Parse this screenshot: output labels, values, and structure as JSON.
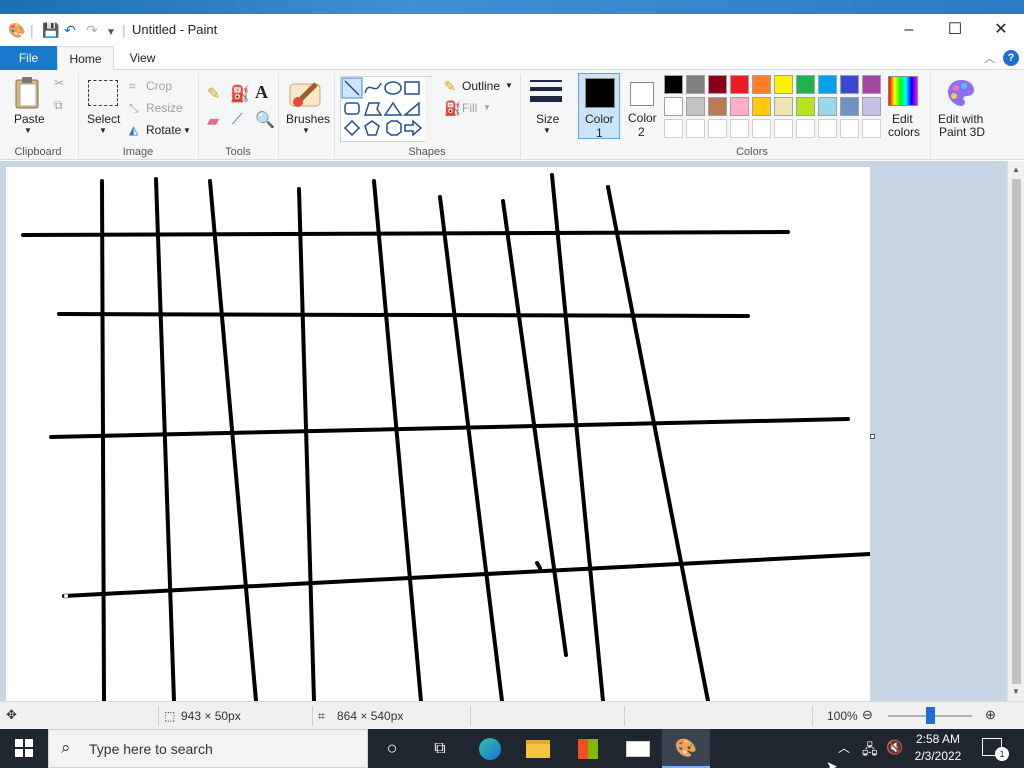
{
  "window": {
    "title": "Untitled - Paint"
  },
  "menu_tabs": {
    "file": "File",
    "home": "Home",
    "view": "View"
  },
  "ribbon": {
    "clipboard": {
      "paste": "Paste",
      "group": "Clipboard"
    },
    "image": {
      "select": "Select",
      "crop": "Crop",
      "resize": "Resize",
      "rotate": "Rotate",
      "group": "Image"
    },
    "tools": {
      "group": "Tools"
    },
    "brushes": {
      "label": "Brushes"
    },
    "shapes": {
      "outline": "Outline",
      "fill": "Fill",
      "group": "Shapes"
    },
    "size": {
      "label": "Size"
    },
    "colors": {
      "color1_label": "Color",
      "color1_num": "1",
      "color2_label": "Color",
      "color2_num": "2",
      "edit_colors_1": "Edit",
      "edit_colors_2": "colors",
      "group": "Colors",
      "color1": "#000000",
      "color2": "#ffffff",
      "palette_row1": [
        "#000000",
        "#7f7f7f",
        "#880015",
        "#ed1c24",
        "#ff7f27",
        "#fff200",
        "#22b14c",
        "#00a2e8",
        "#3f48cc",
        "#a349a4"
      ],
      "palette_row2": [
        "#ffffff",
        "#c3c3c3",
        "#b97a57",
        "#ffaec9",
        "#ffc90e",
        "#efe4b0",
        "#b5e61d",
        "#99d9ea",
        "#7092be",
        "#c8bfe7"
      ],
      "palette_row3": [
        "#ffffff",
        "#ffffff",
        "#ffffff",
        "#ffffff",
        "#ffffff",
        "#ffffff",
        "#ffffff",
        "#ffffff",
        "#ffffff",
        "#ffffff"
      ]
    },
    "paint3d": {
      "line1": "Edit with",
      "line2": "Paint 3D"
    }
  },
  "status": {
    "selection_size": "943 × 50px",
    "canvas_size": "864 × 540px",
    "zoom": "100%",
    "zoom_level": 0.5
  },
  "taskbar": {
    "search_placeholder": "Type here to search",
    "time": "2:58 AM",
    "date": "2/3/2022",
    "notification_count": "1"
  }
}
